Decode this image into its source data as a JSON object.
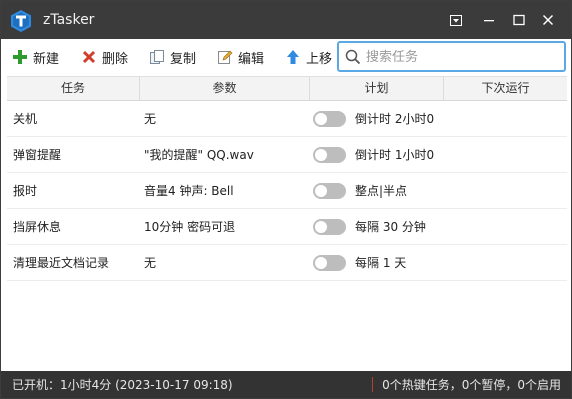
{
  "window": {
    "title": "zTasker",
    "icon": "ztasker-logo",
    "controls": [
      "menu-dropdown-icon",
      "minimize-icon",
      "maximize-icon",
      "close-icon"
    ]
  },
  "toolbar": {
    "new_label": "新建",
    "delete_label": "删除",
    "copy_label": "复制",
    "edit_label": "编辑",
    "move_up_label": "上移",
    "search_placeholder": "搜索任务",
    "colors": {
      "new": "#2e9b2e",
      "delete": "#d23c2c",
      "move_up": "#2f8be0",
      "search_border": "#5aa9e6"
    }
  },
  "table": {
    "columns": [
      "任务",
      "参数",
      "计划",
      "下次运行"
    ],
    "rows": [
      {
        "task": "关机",
        "params": "无",
        "enabled": false,
        "plan": "倒计时 2小时0",
        "next": ""
      },
      {
        "task": "弹窗提醒",
        "params": "\"我的提醒\" QQ.wav",
        "enabled": false,
        "plan": "倒计时 1小时0",
        "next": ""
      },
      {
        "task": "报时",
        "params": "音量4 钟声: Bell",
        "enabled": false,
        "plan": "整点|半点",
        "next": ""
      },
      {
        "task": "挡屏休息",
        "params": "10分钟 密码可退",
        "enabled": false,
        "plan": "每隔 30 分钟",
        "next": ""
      },
      {
        "task": "清理最近文档记录",
        "params": "无",
        "enabled": false,
        "plan": "每隔 1 天",
        "next": ""
      }
    ]
  },
  "status": {
    "uptime": "已开机：1小时4分 (2023-10-17 09:18)",
    "summary": "0个热键任务，0个暂停，0个启用"
  }
}
